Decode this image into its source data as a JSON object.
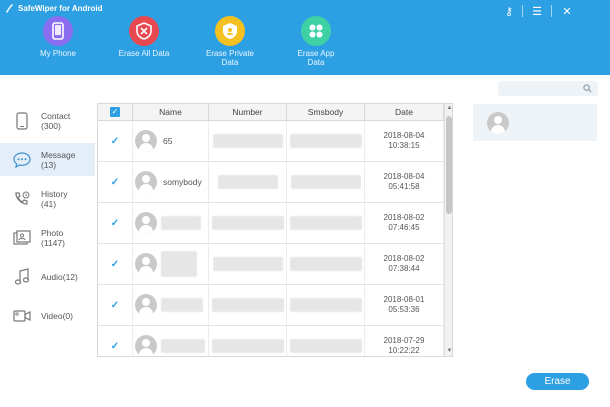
{
  "app": {
    "title": "SafeWiper for Android"
  },
  "window_controls": {
    "key": "⚷",
    "menu": "☰",
    "close": "✕"
  },
  "nav": [
    {
      "label": "My Phone",
      "color": "#8a6df0"
    },
    {
      "label": "Erase All Data",
      "color": "#e8484f"
    },
    {
      "label": "Erase Private Data",
      "color": "#f5c121"
    },
    {
      "label": "Erase App Data",
      "color": "#3ed1a6"
    }
  ],
  "sidebar": [
    {
      "label": "Contact",
      "count": "(300)",
      "icon": "phone-icon"
    },
    {
      "label": "Message",
      "count": "(13)",
      "icon": "message-icon",
      "active": true
    },
    {
      "label": "History",
      "count": "(41)",
      "icon": "call-history-icon"
    },
    {
      "label": "Photo",
      "count": "(1147)",
      "icon": "photo-icon"
    },
    {
      "label": "Audio(12)",
      "count": "",
      "icon": "music-icon"
    },
    {
      "label": "Video(0)",
      "count": "",
      "icon": "video-icon"
    }
  ],
  "table": {
    "columns": [
      "",
      "Name",
      "Number",
      "Smsbody",
      "Date"
    ],
    "rows": [
      {
        "name": "65",
        "date": "2018-08-04",
        "time": "10:38:15"
      },
      {
        "name": "somybody",
        "date": "2018-08-04",
        "time": "05:41:58"
      },
      {
        "name": "",
        "date": "2018-08-02",
        "time": "07:46:45"
      },
      {
        "name": "",
        "date": "2018-08-02",
        "time": "07:38:44"
      },
      {
        "name": "",
        "date": "2018-08-01",
        "time": "05:53:36"
      },
      {
        "name": "",
        "date": "2018-07-29",
        "time": "10:22:22"
      }
    ]
  },
  "actions": {
    "erase": "Erase"
  },
  "colors": {
    "accent": "#2d9fe3",
    "header": "#2d9fe3"
  }
}
